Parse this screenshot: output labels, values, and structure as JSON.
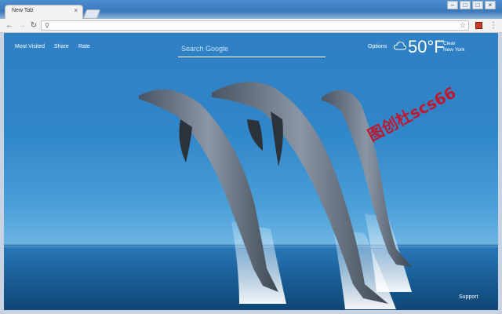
{
  "browser": {
    "tab_title": "New Tab",
    "tab_close": "×",
    "omnibox_value": "",
    "menu_glyph": "⋮",
    "star_glyph": "☆",
    "controls": [
      "–",
      "□",
      "×"
    ]
  },
  "page": {
    "nav": [
      {
        "label": "Most Visited"
      },
      {
        "label": "Share"
      },
      {
        "label": "Rate"
      }
    ],
    "search": {
      "placeholder": "Search Google"
    },
    "options_label": "Options",
    "weather": {
      "temp": "50°F",
      "condition": "Clear",
      "location": "New York",
      "icon": "cloud-icon"
    },
    "watermark": "图创杜scs66",
    "support_label": "Support"
  },
  "colors": {
    "sky_top": "#2f7fc4",
    "sea": "#17598f",
    "watermark": "#c0172e",
    "text_on_page": "#ffffff"
  }
}
